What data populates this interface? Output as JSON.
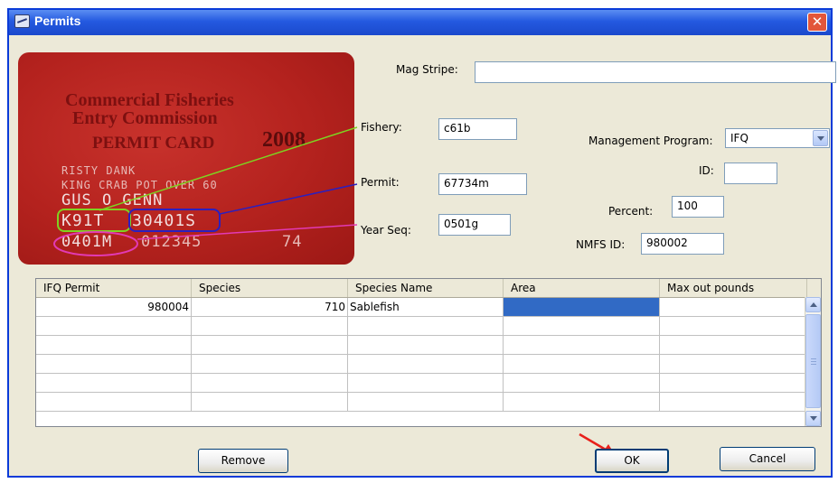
{
  "window": {
    "title": "Permits",
    "close_glyph": "✕"
  },
  "card": {
    "line1": "Commercial Fisheries",
    "line2": "Entry Commission",
    "line3": "PERMIT CARD",
    "year": "2008",
    "name_line1": "RISTY DANK",
    "name_line2": "KING CRAB POT OVER 60",
    "holder_name": "GUS O GENN",
    "fishery_code": "K91T",
    "permit_code": "30401S",
    "year_seq_code": "0401M",
    "serial": "012345",
    "number": "74"
  },
  "form": {
    "mag_stripe_label": "Mag Stripe:",
    "mag_stripe_value": "",
    "fishery_label": "Fishery:",
    "fishery_value": "c61b",
    "permit_label": "Permit:",
    "permit_value": "67734m",
    "year_seq_label": "Year Seq:",
    "year_seq_value": "0501g",
    "mgmt_label": "Management Program:",
    "mgmt_value": "IFQ",
    "id_label": "ID:",
    "id_value": "",
    "percent_label": "Percent:",
    "percent_value": "100",
    "nmfs_label": "NMFS ID:",
    "nmfs_value": "980002"
  },
  "table": {
    "columns": [
      "IFQ Permit",
      "Species",
      "Species Name",
      "Area",
      "Max out pounds"
    ],
    "rows": [
      {
        "ifq_permit": "980004",
        "species": "710",
        "species_name": "Sablefish",
        "area": "",
        "max_out": ""
      }
    ]
  },
  "buttons": {
    "remove": "Remove",
    "ok": "OK",
    "cancel": "Cancel"
  },
  "colors": {
    "title_bar": "#2459e0",
    "fishery_line": "#7ed321",
    "permit_line": "#2b1fbf",
    "yearseq_line": "#e23ab5",
    "annotation_arrow": "#e8201a",
    "selection": "#316ac5"
  }
}
